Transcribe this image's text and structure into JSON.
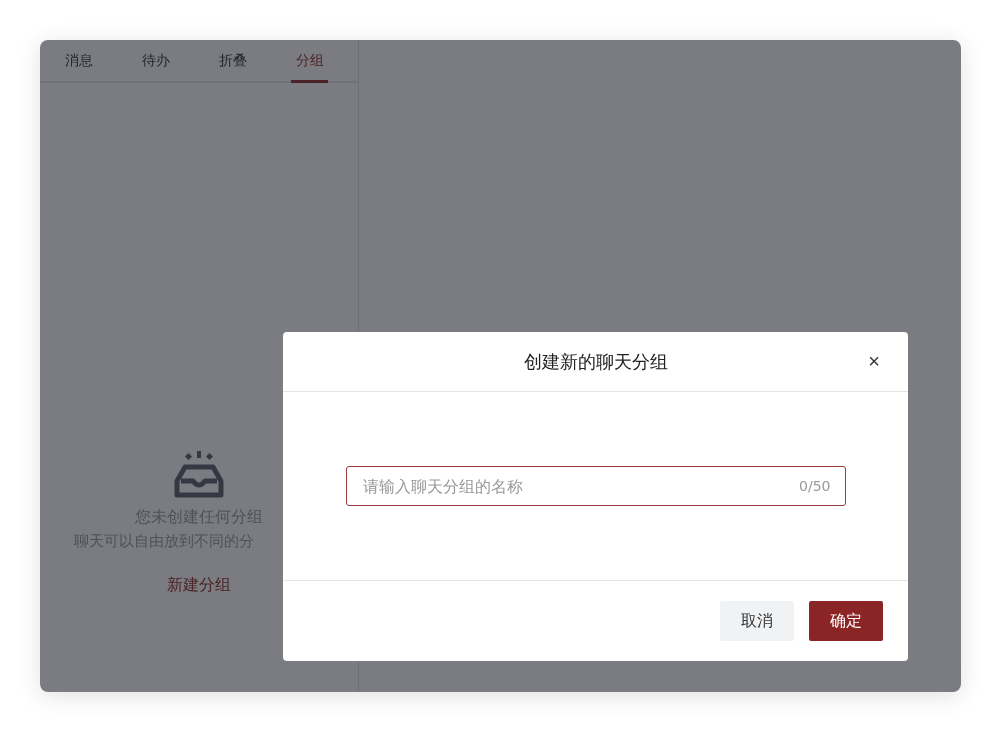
{
  "tabs": [
    {
      "label": "消息",
      "selected": false
    },
    {
      "label": "待办",
      "selected": false
    },
    {
      "label": "折叠",
      "selected": false
    },
    {
      "label": "分组",
      "selected": true
    }
  ],
  "empty_state": {
    "title": "您未创建任何分组",
    "description": "聊天可以自由放到不同的分",
    "action": "新建分组"
  },
  "dialog": {
    "title": "创建新的聊天分组",
    "close": "×",
    "field": {
      "placeholder": "请输入聊天分组的名称",
      "counter": "0/50"
    },
    "buttons": [
      {
        "label": "取消",
        "kind": "secondary"
      },
      {
        "label": "确定",
        "kind": "primary"
      }
    ]
  }
}
